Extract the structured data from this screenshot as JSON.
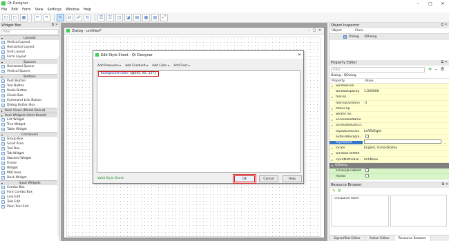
{
  "window": {
    "title": "Qt Designer"
  },
  "menu": [
    "File",
    "Edit",
    "Form",
    "View",
    "Settings",
    "Window",
    "Help"
  ],
  "widget_box": {
    "title": "Widget Box",
    "filter_placeholder": "Filter",
    "items": [
      {
        "kind": "cat",
        "label": "Layouts"
      },
      {
        "kind": "item",
        "label": "Vertical Layout"
      },
      {
        "kind": "item",
        "label": "Horizontal Layout"
      },
      {
        "kind": "item",
        "label": "Grid Layout"
      },
      {
        "kind": "item",
        "label": "Form Layout"
      },
      {
        "kind": "cat",
        "label": "Spacers"
      },
      {
        "kind": "item",
        "label": "Horizontal Spacer"
      },
      {
        "kind": "item",
        "label": "Vertical Spacer"
      },
      {
        "kind": "cat",
        "label": "Buttons"
      },
      {
        "kind": "item",
        "label": "Push Button"
      },
      {
        "kind": "item",
        "label": "Tool Button"
      },
      {
        "kind": "item",
        "label": "Radio Button"
      },
      {
        "kind": "item",
        "label": "Check Box"
      },
      {
        "kind": "item",
        "label": "Command Link Button"
      },
      {
        "kind": "item",
        "label": "Dialog Button Box"
      },
      {
        "kind": "catl",
        "label": "Item Views (Model-Based)"
      },
      {
        "kind": "catl",
        "label": "Item Widgets (Item-Based)"
      },
      {
        "kind": "item",
        "label": "List Widget"
      },
      {
        "kind": "item",
        "label": "Tree Widget"
      },
      {
        "kind": "item",
        "label": "Table Widget"
      },
      {
        "kind": "cat",
        "label": "Containers"
      },
      {
        "kind": "item",
        "label": "Group Box"
      },
      {
        "kind": "item",
        "label": "Scroll Area"
      },
      {
        "kind": "item",
        "label": "Tool Box"
      },
      {
        "kind": "item",
        "label": "Tab Widget"
      },
      {
        "kind": "item",
        "label": "Stacked Widget"
      },
      {
        "kind": "item",
        "label": "Frame"
      },
      {
        "kind": "item",
        "label": "Widget"
      },
      {
        "kind": "item",
        "label": "MDI Area"
      },
      {
        "kind": "item",
        "label": "Dock Widget"
      },
      {
        "kind": "cat",
        "label": "Input Widgets"
      },
      {
        "kind": "item",
        "label": "Combo Box"
      },
      {
        "kind": "item",
        "label": "Font Combo Box"
      },
      {
        "kind": "item",
        "label": "Line Edit"
      },
      {
        "kind": "item",
        "label": "Text Edit"
      },
      {
        "kind": "item",
        "label": "Plain Text Edit"
      }
    ]
  },
  "form": {
    "title": "Dialog - untitled*"
  },
  "dialog": {
    "title": "Edit Style Sheet - Qt Designer",
    "tools": [
      "Add Resource",
      "Add Gradient",
      "Add Color",
      "Add Font"
    ],
    "code_prop": "background-color:",
    "code_val": "rgb(85, 85, 127);",
    "status": "Valid Style Sheet",
    "ok": "OK",
    "cancel": "Cancel",
    "help": "Help"
  },
  "object_inspector": {
    "title": "Object Inspector",
    "col_object": "Object",
    "col_class": "Class",
    "row_object": "Dialog",
    "row_class": "QDialog"
  },
  "property_editor": {
    "title": "Property Editor",
    "filter_placeholder": "Filter",
    "object_line": "Dialog : QDialog",
    "col_property": "Property",
    "col_value": "Value",
    "rows": [
      {
        "name": "windowIcon",
        "value": "",
        "exp": true
      },
      {
        "name": "windowOpacity",
        "value": "1.000000"
      },
      {
        "name": "toolTip",
        "value": "",
        "exp": true
      },
      {
        "name": "toolTipDuration",
        "value": "-1"
      },
      {
        "name": "statusTip",
        "value": "",
        "exp": true
      },
      {
        "name": "whatsThis",
        "value": "",
        "exp": true
      },
      {
        "name": "accessibleName",
        "value": "",
        "exp": true
      },
      {
        "name": "accessibleDescri...",
        "value": "",
        "exp": true
      },
      {
        "name": "layoutDirection",
        "value": "LeftToRight"
      },
      {
        "name": "autoFillBackgro...",
        "value": "",
        "check": true
      },
      {
        "name": "styleSheet",
        "value": "",
        "selected": true
      },
      {
        "name": "locale",
        "value": "English, UnitedStates",
        "exp": true
      },
      {
        "name": "windowFilePath",
        "value": "",
        "exp": true
      },
      {
        "name": "inputMethodHi...",
        "value": "ImhNone",
        "exp": true
      }
    ],
    "section": "QDialog",
    "section_rows": [
      {
        "name": "sizeGripEnabled",
        "check": true
      },
      {
        "name": "modal",
        "check": true
      }
    ]
  },
  "resource_browser": {
    "title": "Resource Browser",
    "root": "<resource root>",
    "tabs": [
      "Signal/Slot Editor",
      "Action Editor",
      "Resource Browser"
    ]
  }
}
